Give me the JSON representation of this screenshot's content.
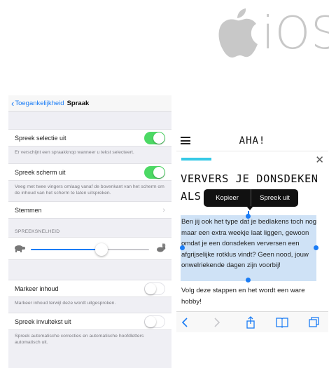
{
  "branding": {
    "ios_text": "iOS"
  },
  "settings": {
    "nav": {
      "back_label": "Toegankelijkheid",
      "title": "Spraak"
    },
    "speak_selection": {
      "label": "Spreek selectie uit",
      "on": true,
      "note": "Er verschijnt een spraakknop wanneer u tekst selecteert."
    },
    "speak_screen": {
      "label": "Spreek scherm uit",
      "on": true,
      "note": "Veeg met twee vingers omlaag vanaf de bovenkant van het scherm om de inhoud van het scherm te laten uitspreken."
    },
    "voices": {
      "label": "Stemmen"
    },
    "speaking_rate": {
      "header": "SPREEKSNELHEID",
      "value": 0.6
    },
    "highlight": {
      "label": "Markeer inhoud",
      "on": false,
      "note": "Markeer inhoud terwijl deze wordt uitgesproken."
    },
    "typing_feedback": {
      "label": "Spreek invultekst uit",
      "on": false,
      "note": "Spreek automatische correcties en automatische hoofdletters automatisch uit."
    }
  },
  "reader": {
    "logo": "AHA!",
    "headline": "VERVERS JE DONSDEKEN ALS EEN PRO",
    "context_menu": {
      "copy": "Kopieer",
      "speak": "Spreek uit"
    },
    "paragraph1": "Ben jij ook het type dat je bedlakens toch nog maar een extra weekje laat liggen, gewoon omdat je een donsdeken verversen een afgrijselijke rotklus vindt? Geen nood, jouw onwelriekende dagen zijn voorbij!",
    "paragraph2": "Volg deze stappen en het wordt een ware hobby!",
    "reading_progress": 0.2
  },
  "colors": {
    "accent_blue": "#1a7cf5",
    "toggle_green": "#4cd964",
    "progress_cyan": "#36c9e6",
    "selection": "#cfe2f6"
  }
}
